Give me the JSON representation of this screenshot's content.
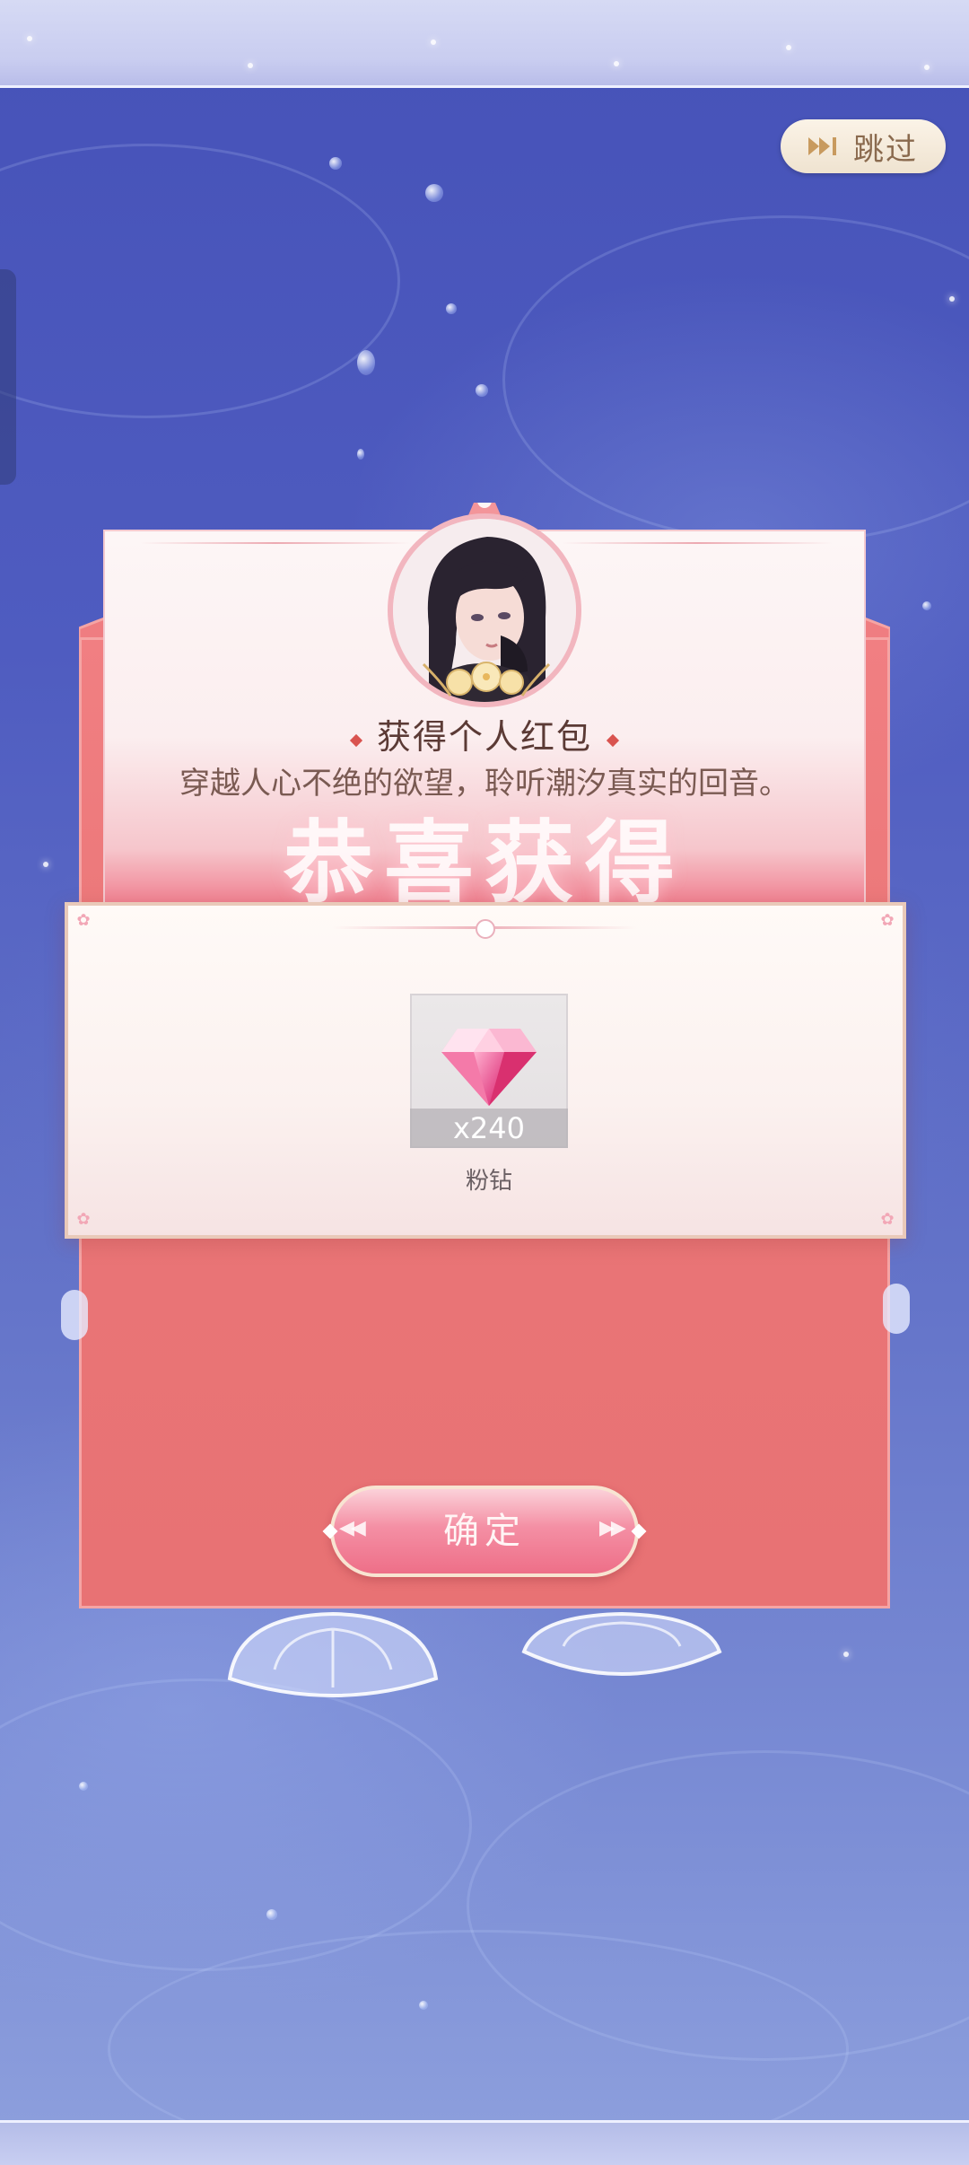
{
  "header": {
    "skip_label": "跳过",
    "skip_icon": "fast-forward-icon"
  },
  "letter": {
    "title": "获得个人红包",
    "subtitle": "穿越人心不绝的欲望，聆听潮汐真实的回音。"
  },
  "banner": {
    "congrats": "恭喜获得"
  },
  "reward": {
    "item_name": "粉钻",
    "item_count": "x240",
    "item_icon": "pink-diamond-icon"
  },
  "footer": {
    "confirm_label": "确定"
  },
  "colors": {
    "envelope_red": "#ea7677",
    "button_pink": "#f48fa4",
    "background_blue": "#4f5cc0",
    "panel_cream": "#fffaf7"
  }
}
